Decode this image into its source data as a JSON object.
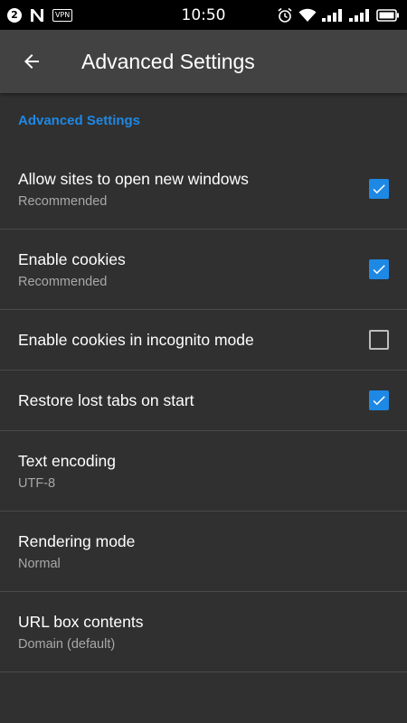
{
  "status_bar": {
    "notification_count": "2",
    "vpn_label": "VPN",
    "time": "10:50",
    "icons": [
      "notification-badge-icon",
      "n-logo-icon",
      "vpn-icon",
      "alarm-icon",
      "wifi-icon",
      "signal-icon",
      "signal-icon",
      "battery-icon"
    ]
  },
  "toolbar": {
    "title": "Advanced Settings",
    "back_icon": "arrow-back-icon"
  },
  "section": {
    "header": "Advanced Settings"
  },
  "settings": [
    {
      "title": "Allow sites to open new windows",
      "summary": "Recommended",
      "checked": true
    },
    {
      "title": "Enable cookies",
      "summary": "Recommended",
      "checked": true
    },
    {
      "title": "Enable cookies in incognito mode",
      "checked": false
    },
    {
      "title": "Restore lost tabs on start",
      "checked": true
    },
    {
      "title": "Text encoding",
      "summary": "UTF-8"
    },
    {
      "title": "Rendering mode",
      "summary": "Normal"
    },
    {
      "title": "URL box contents",
      "summary": "Domain (default)"
    }
  ],
  "colors": {
    "accent": "#1e88e5",
    "background": "#303030",
    "toolbar": "#424242",
    "status_bar": "#000000",
    "summary_text": "#a8a8a8",
    "divider": "#4a4a4a"
  }
}
